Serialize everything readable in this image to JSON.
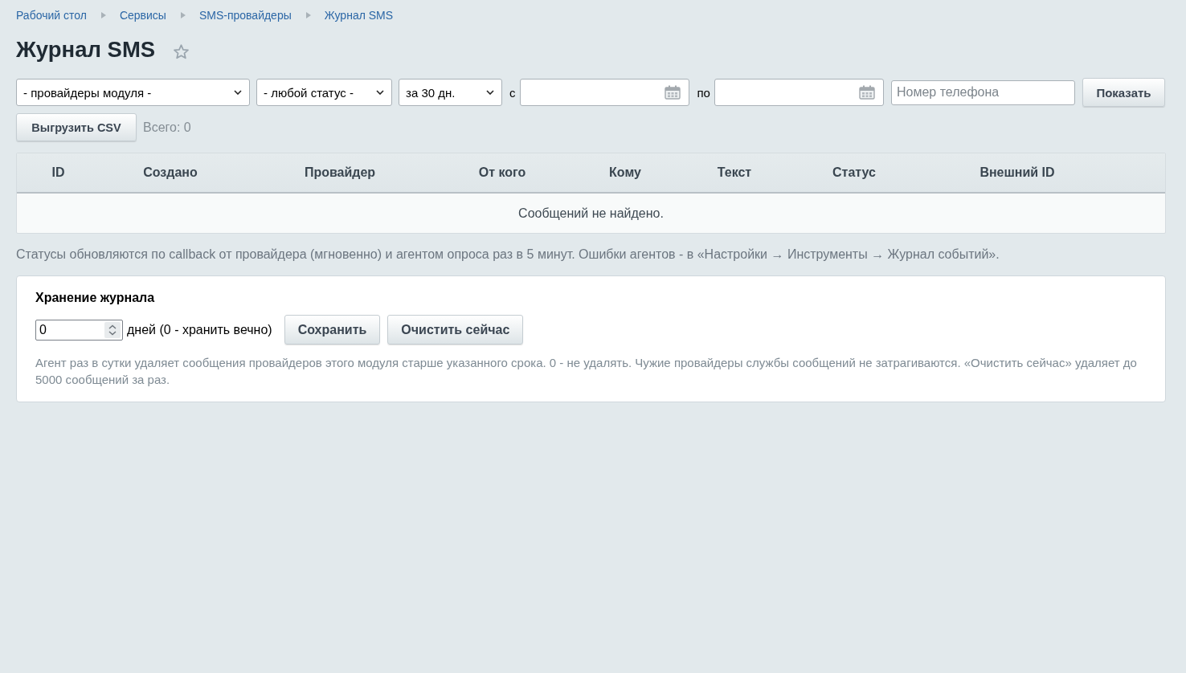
{
  "breadcrumbs": [
    {
      "label": "Рабочий стол"
    },
    {
      "label": "Сервисы"
    },
    {
      "label": "SMS-провайдеры"
    },
    {
      "label": "Журнал SMS"
    }
  ],
  "title": "Журнал SMS",
  "filters": [
    {
      "kind": "select",
      "value": "- провайдеры модуля -"
    },
    {
      "kind": "select",
      "value": "- любой статус -"
    },
    {
      "kind": "select",
      "value": "за 30 дн."
    },
    {
      "kind": "date",
      "label": "с"
    },
    {
      "kind": "date",
      "label": "по"
    },
    {
      "kind": "text",
      "placeholder": "Номер телефона"
    },
    {
      "kind": "button",
      "label": "Показать"
    }
  ],
  "export_button": "Выгрузить CSV",
  "total": "Всего: 0",
  "table": {
    "columns": [
      "ID",
      "Создано",
      "Провайдер",
      "От кого",
      "Кому",
      "Текст",
      "Статус",
      "Внешний ID"
    ],
    "empty_message": "Сообщений не найдено."
  },
  "note": "Статусы обновляются по callback от провайдера (мгновенно) и агентом опроса раз в 5 минут. Ошибки агентов - в «Настройки → Инструменты → Журнал событий».",
  "retention": {
    "title": "Хранение журнала",
    "days": "0",
    "days_label": "дней (0 - хранить вечно)",
    "buttons": [
      "Сохранить",
      "Очистить сейчас"
    ],
    "hint": "Агент раз в сутки удаляет сообщения провайдеров этого модуля старше указанного срока. 0 - не удалять. Чужие провайдеры службы сообщений не затрагиваются. «Очистить сейчас» удаляет до 5000 сообщений за раз."
  }
}
